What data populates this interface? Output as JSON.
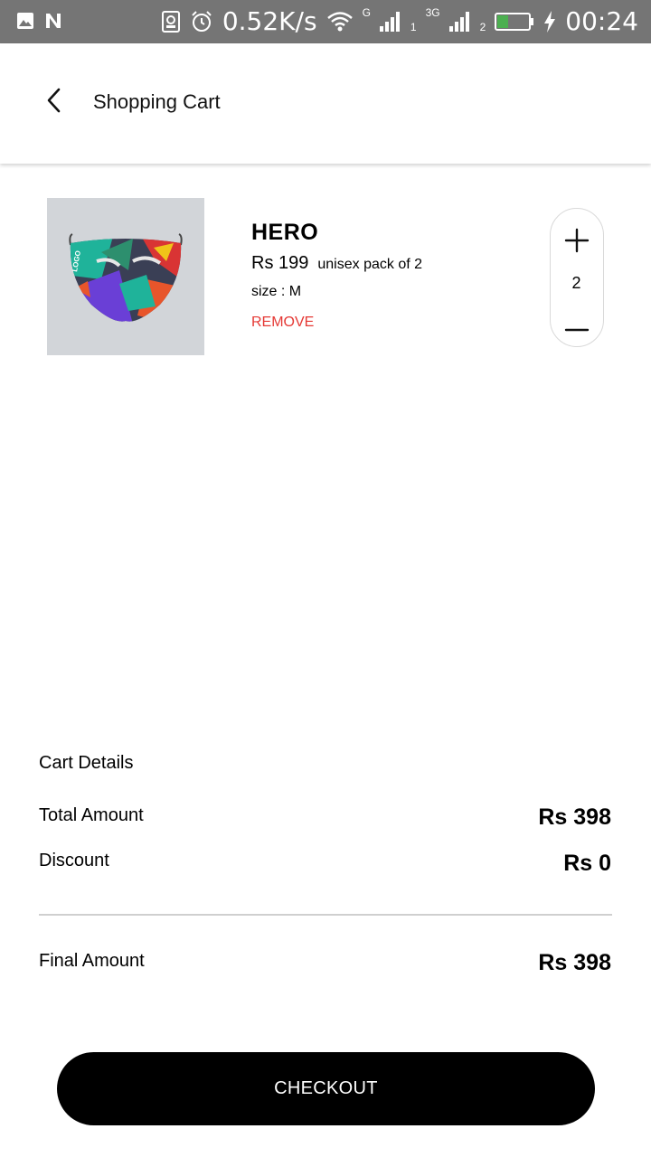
{
  "status_bar": {
    "speed": "0.52K/s",
    "sim1_label": "G",
    "sim1_index": "1",
    "sim2_label": "3G",
    "sim2_index": "2",
    "battery_level": 0.35,
    "time": "00:24",
    "icons": [
      "image-icon",
      "n-icon",
      "sim-icon",
      "alarm-icon",
      "wifi-icon",
      "signal-icon",
      "battery-icon",
      "charging-icon"
    ]
  },
  "header": {
    "title": "Shopping Cart",
    "back_icon": "back-arrow-icon"
  },
  "cart": {
    "items": [
      {
        "name": "HERO",
        "price": "Rs 199",
        "variant": "unisex pack of 2",
        "size": "size : M",
        "remove_label": "REMOVE",
        "quantity": "2",
        "image_label": "LOGO"
      }
    ]
  },
  "details": {
    "title": "Cart Details",
    "total_label": "Total Amount",
    "total_value": "Rs 398",
    "discount_label": "Discount",
    "discount_value": "Rs 0",
    "final_label": "Final Amount",
    "final_value": "Rs 398"
  },
  "checkout": {
    "label": "CHECKOUT"
  },
  "colors": {
    "status_bar": "#757575",
    "remove": "#e53935",
    "checkout_bg": "#000000",
    "image_bg": "#d2d5d9",
    "battery_fill": "#4caf50"
  }
}
